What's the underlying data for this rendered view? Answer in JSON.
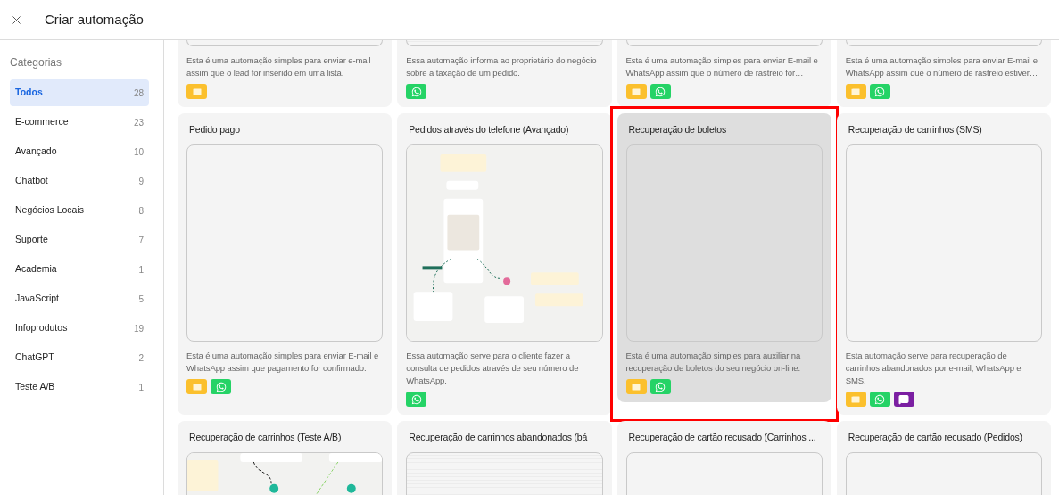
{
  "header": {
    "title": "Criar automação"
  },
  "sidebar": {
    "heading": "Categorias",
    "items": [
      {
        "label": "Todos",
        "count": "28",
        "selected": true
      },
      {
        "label": "E-commerce",
        "count": "23",
        "selected": false
      },
      {
        "label": "Avançado",
        "count": "10",
        "selected": false
      },
      {
        "label": "Chatbot",
        "count": "9",
        "selected": false
      },
      {
        "label": "Negócios Locais",
        "count": "8",
        "selected": false
      },
      {
        "label": "Suporte",
        "count": "7",
        "selected": false
      },
      {
        "label": "Academia",
        "count": "1",
        "selected": false
      },
      {
        "label": "JavaScript",
        "count": "5",
        "selected": false
      },
      {
        "label": "Infoprodutos",
        "count": "19",
        "selected": false
      },
      {
        "label": "ChatGPT",
        "count": "2",
        "selected": false
      },
      {
        "label": "Teste A/B",
        "count": "1",
        "selected": false
      }
    ]
  },
  "card_rows": [
    {
      "cards": [
        {
          "selected": false,
          "kind": "blank",
          "description": "Esta é uma automação simples para enviar e-mail assim que o lead for inserido em uma lista.",
          "channels": [
            {
              "kind": "email"
            }
          ]
        },
        {
          "selected": false,
          "kind": "grid",
          "description": "Essa automação informa ao proprietário do negócio sobre a taxação de um pedido.",
          "channels": [
            {
              "kind": "whatsapp"
            }
          ]
        },
        {
          "selected": false,
          "kind": "blank",
          "description": "Esta é uma automação simples para enviar E-mail e WhatsApp assim que o número de rastreio for…",
          "channels": [
            {
              "kind": "email"
            },
            {
              "kind": "whatsapp"
            }
          ]
        },
        {
          "selected": false,
          "kind": "blank",
          "description": "Esta é uma automação simples para enviar E-mail e WhatsApp assim que o número de rastreio estiver…",
          "channels": [
            {
              "kind": "email"
            },
            {
              "kind": "whatsapp"
            }
          ]
        }
      ]
    },
    {
      "cards": [
        {
          "title": "Pedido pago",
          "selected": false,
          "kind": "blank",
          "description": "Esta é uma automação simples para enviar E-mail e WhatsApp assim que pagamento for confirmado.",
          "channels": [
            {
              "kind": "email"
            },
            {
              "kind": "whatsapp"
            }
          ]
        },
        {
          "title": "Pedidos através do telefone (Avançado)",
          "selected": false,
          "kind": "picture",
          "description": "Essa automação serve para o cliente fazer a consulta de pedidos através de seu número de WhatsApp.",
          "channels": [
            {
              "kind": "whatsapp"
            }
          ]
        },
        {
          "title": "Recuperação de boletos",
          "selected": true,
          "kind": "blank",
          "description": "Esta é uma automação simples para auxiliar na recuperação de boletos do seu negócio on-line.",
          "channels": [
            {
              "kind": "email"
            },
            {
              "kind": "whatsapp"
            }
          ]
        },
        {
          "title": "Recuperação de carrinhos (SMS)",
          "selected": false,
          "kind": "blank",
          "description": "Esta automação serve para recuperação de carrinhos abandonados por e-mail, WhatsApp e SMS.",
          "channels": [
            {
              "kind": "email"
            },
            {
              "kind": "whatsapp"
            },
            {
              "kind": "sms"
            }
          ]
        }
      ]
    },
    {
      "cards": [
        {
          "title": "Recuperação de carrinhos (Teste A/B)",
          "selected": false,
          "kind": "picture"
        },
        {
          "title": "Recuperação de carrinhos abandonados (bá",
          "selected": false,
          "kind": "grid"
        },
        {
          "title": "Recuperação de cartão recusado (Carrinhos ...",
          "selected": false,
          "kind": "blank"
        },
        {
          "title": "Recuperação de cartão recusado (Pedidos)",
          "selected": false,
          "kind": "blank"
        }
      ]
    }
  ]
}
